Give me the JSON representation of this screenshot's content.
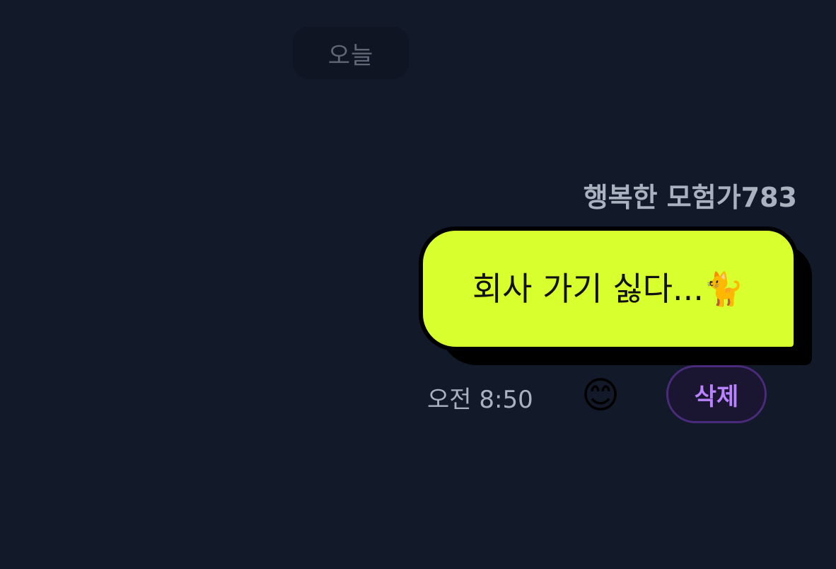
{
  "chat": {
    "date_divider": "오늘",
    "message": {
      "sender": "행복한 모험가783",
      "text": "회사 가기 싫다...🐈",
      "time": "오전 8:50",
      "reaction_icon": "smiling-face-emoji",
      "reaction_glyph": "😊",
      "delete_label": "삭제",
      "bubble_color": "#d8ff2e"
    }
  }
}
